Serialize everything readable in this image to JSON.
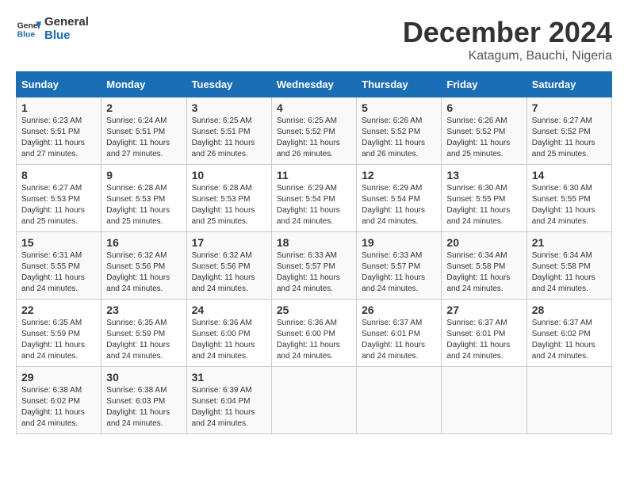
{
  "logo": {
    "line1": "General",
    "line2": "Blue"
  },
  "title": "December 2024",
  "location": "Katagum, Bauchi, Nigeria",
  "days_of_week": [
    "Sunday",
    "Monday",
    "Tuesday",
    "Wednesday",
    "Thursday",
    "Friday",
    "Saturday"
  ],
  "weeks": [
    [
      {
        "day": "1",
        "info": "Sunrise: 6:23 AM\nSunset: 5:51 PM\nDaylight: 11 hours\nand 27 minutes."
      },
      {
        "day": "2",
        "info": "Sunrise: 6:24 AM\nSunset: 5:51 PM\nDaylight: 11 hours\nand 27 minutes."
      },
      {
        "day": "3",
        "info": "Sunrise: 6:25 AM\nSunset: 5:51 PM\nDaylight: 11 hours\nand 26 minutes."
      },
      {
        "day": "4",
        "info": "Sunrise: 6:25 AM\nSunset: 5:52 PM\nDaylight: 11 hours\nand 26 minutes."
      },
      {
        "day": "5",
        "info": "Sunrise: 6:26 AM\nSunset: 5:52 PM\nDaylight: 11 hours\nand 26 minutes."
      },
      {
        "day": "6",
        "info": "Sunrise: 6:26 AM\nSunset: 5:52 PM\nDaylight: 11 hours\nand 25 minutes."
      },
      {
        "day": "7",
        "info": "Sunrise: 6:27 AM\nSunset: 5:52 PM\nDaylight: 11 hours\nand 25 minutes."
      }
    ],
    [
      {
        "day": "8",
        "info": "Sunrise: 6:27 AM\nSunset: 5:53 PM\nDaylight: 11 hours\nand 25 minutes."
      },
      {
        "day": "9",
        "info": "Sunrise: 6:28 AM\nSunset: 5:53 PM\nDaylight: 11 hours\nand 25 minutes."
      },
      {
        "day": "10",
        "info": "Sunrise: 6:28 AM\nSunset: 5:53 PM\nDaylight: 11 hours\nand 25 minutes."
      },
      {
        "day": "11",
        "info": "Sunrise: 6:29 AM\nSunset: 5:54 PM\nDaylight: 11 hours\nand 24 minutes."
      },
      {
        "day": "12",
        "info": "Sunrise: 6:29 AM\nSunset: 5:54 PM\nDaylight: 11 hours\nand 24 minutes."
      },
      {
        "day": "13",
        "info": "Sunrise: 6:30 AM\nSunset: 5:55 PM\nDaylight: 11 hours\nand 24 minutes."
      },
      {
        "day": "14",
        "info": "Sunrise: 6:30 AM\nSunset: 5:55 PM\nDaylight: 11 hours\nand 24 minutes."
      }
    ],
    [
      {
        "day": "15",
        "info": "Sunrise: 6:31 AM\nSunset: 5:55 PM\nDaylight: 11 hours\nand 24 minutes."
      },
      {
        "day": "16",
        "info": "Sunrise: 6:32 AM\nSunset: 5:56 PM\nDaylight: 11 hours\nand 24 minutes."
      },
      {
        "day": "17",
        "info": "Sunrise: 6:32 AM\nSunset: 5:56 PM\nDaylight: 11 hours\nand 24 minutes."
      },
      {
        "day": "18",
        "info": "Sunrise: 6:33 AM\nSunset: 5:57 PM\nDaylight: 11 hours\nand 24 minutes."
      },
      {
        "day": "19",
        "info": "Sunrise: 6:33 AM\nSunset: 5:57 PM\nDaylight: 11 hours\nand 24 minutes."
      },
      {
        "day": "20",
        "info": "Sunrise: 6:34 AM\nSunset: 5:58 PM\nDaylight: 11 hours\nand 24 minutes."
      },
      {
        "day": "21",
        "info": "Sunrise: 6:34 AM\nSunset: 5:58 PM\nDaylight: 11 hours\nand 24 minutes."
      }
    ],
    [
      {
        "day": "22",
        "info": "Sunrise: 6:35 AM\nSunset: 5:59 PM\nDaylight: 11 hours\nand 24 minutes."
      },
      {
        "day": "23",
        "info": "Sunrise: 6:35 AM\nSunset: 5:59 PM\nDaylight: 11 hours\nand 24 minutes."
      },
      {
        "day": "24",
        "info": "Sunrise: 6:36 AM\nSunset: 6:00 PM\nDaylight: 11 hours\nand 24 minutes."
      },
      {
        "day": "25",
        "info": "Sunrise: 6:36 AM\nSunset: 6:00 PM\nDaylight: 11 hours\nand 24 minutes."
      },
      {
        "day": "26",
        "info": "Sunrise: 6:37 AM\nSunset: 6:01 PM\nDaylight: 11 hours\nand 24 minutes."
      },
      {
        "day": "27",
        "info": "Sunrise: 6:37 AM\nSunset: 6:01 PM\nDaylight: 11 hours\nand 24 minutes."
      },
      {
        "day": "28",
        "info": "Sunrise: 6:37 AM\nSunset: 6:02 PM\nDaylight: 11 hours\nand 24 minutes."
      }
    ],
    [
      {
        "day": "29",
        "info": "Sunrise: 6:38 AM\nSunset: 6:02 PM\nDaylight: 11 hours\nand 24 minutes."
      },
      {
        "day": "30",
        "info": "Sunrise: 6:38 AM\nSunset: 6:03 PM\nDaylight: 11 hours\nand 24 minutes."
      },
      {
        "day": "31",
        "info": "Sunrise: 6:39 AM\nSunset: 6:04 PM\nDaylight: 11 hours\nand 24 minutes."
      },
      {
        "day": "",
        "info": ""
      },
      {
        "day": "",
        "info": ""
      },
      {
        "day": "",
        "info": ""
      },
      {
        "day": "",
        "info": ""
      }
    ]
  ]
}
